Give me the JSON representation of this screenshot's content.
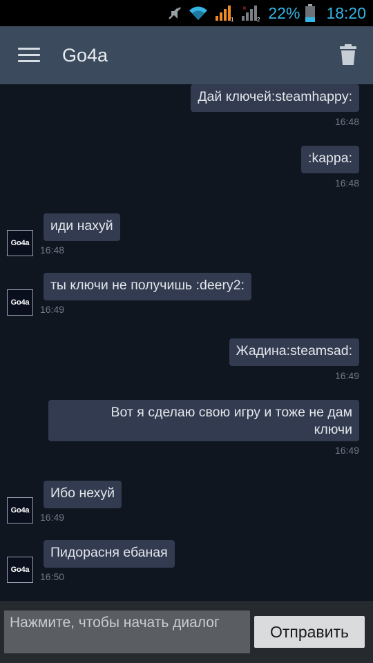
{
  "status_bar": {
    "battery_percent": "22%",
    "time": "18:20",
    "icons": [
      "mute-icon",
      "wifi-icon",
      "signal-sim1-icon",
      "signal-sim2-icon",
      "battery-icon"
    ]
  },
  "header": {
    "title": "Go4a",
    "menu_icon": "menu-icon",
    "delete_icon": "trash-icon"
  },
  "contact": {
    "avatar_text": "Go4a"
  },
  "messages": [
    {
      "direction": "out",
      "text": "Дай ключей:steamhappy:",
      "time": "16:48"
    },
    {
      "direction": "out",
      "text": ":kappa:",
      "time": "16:48"
    },
    {
      "direction": "in",
      "text": "иди нахуй",
      "time": "16:48"
    },
    {
      "direction": "in",
      "text": "ты ключи не получишь :deery2:",
      "time": "16:49"
    },
    {
      "direction": "out",
      "text": "Жадина:steamsad:",
      "time": "16:49"
    },
    {
      "direction": "out",
      "text": "Вот я сделаю свою игру и тоже не дам ключи",
      "time": "16:49"
    },
    {
      "direction": "in",
      "text": "Ибо нехуй",
      "time": "16:49"
    },
    {
      "direction": "in",
      "text": "Пидорасня ебаная",
      "time": "16:50"
    }
  ],
  "composer": {
    "placeholder": "Нажмите, чтобы начать диалог",
    "send_label": "Отправить"
  },
  "colors": {
    "app_bar": "#3b4a5c",
    "chat_background": "#0f1620",
    "bubble": "#323b4f",
    "status_accent": "#34b5e5"
  }
}
